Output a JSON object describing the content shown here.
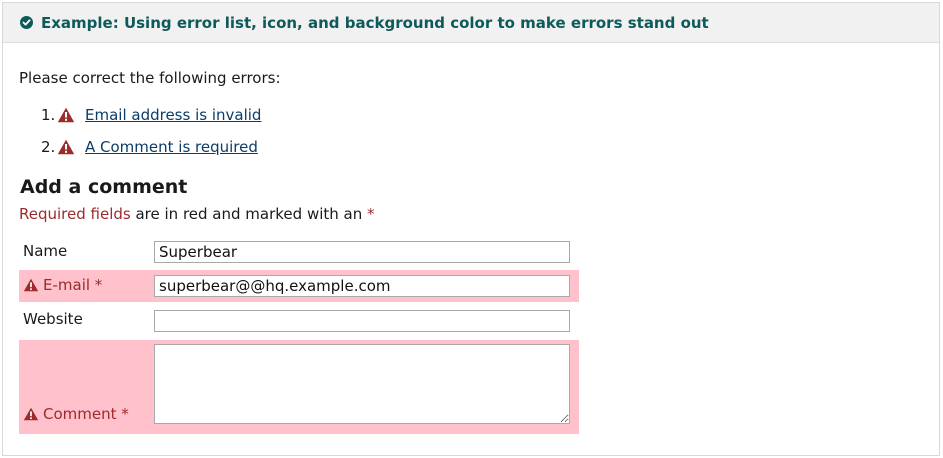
{
  "header": {
    "title": "Example: Using error list, icon, and background color to make errors stand out"
  },
  "errors": {
    "intro": "Please correct the following errors:",
    "items": [
      {
        "num": "1.",
        "label": "Email address is invalid"
      },
      {
        "num": "2.",
        "label": "A Comment is required"
      }
    ]
  },
  "form": {
    "title": "Add a comment",
    "required_note": {
      "prefix": "Required fields",
      "middle": " are in red and marked with an ",
      "marker": "*"
    },
    "fields": {
      "name": {
        "label": "Name",
        "value": "Superbear"
      },
      "email": {
        "label": "E-mail *",
        "value": "superbear@@hq.example.com"
      },
      "website": {
        "label": "Website",
        "value": ""
      },
      "comment": {
        "label": "Comment *",
        "value": ""
      }
    }
  },
  "colors": {
    "header_text": "#0e5a5a",
    "error_text": "#9c2b2b",
    "error_bg": "#ffc1cc",
    "link": "#0b3d6b"
  },
  "icons": {
    "header": "check-circle-icon",
    "error": "warning-triangle-icon"
  }
}
